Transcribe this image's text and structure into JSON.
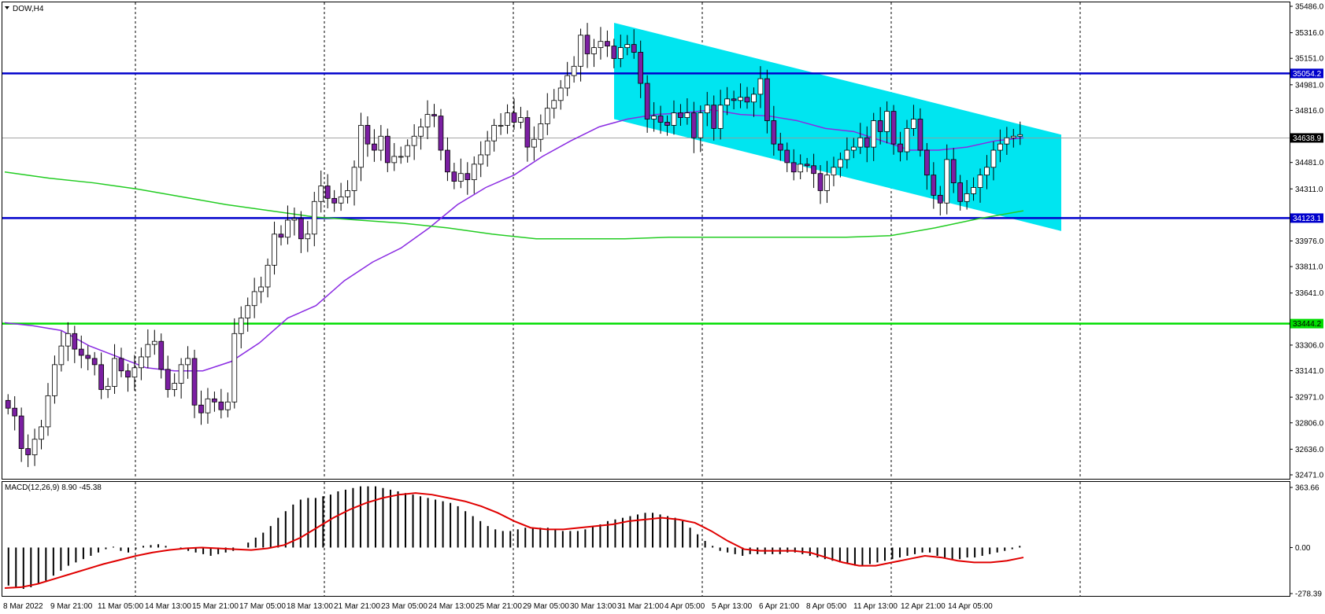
{
  "window_title": "DOW,H4",
  "chart_data": {
    "type": "candlestick",
    "symbol": "DOW",
    "timeframe": "H4",
    "price_range": [
      32471,
      35486
    ],
    "y_ticks": [
      "35486.0",
      "35316.0",
      "35151.0",
      "34981.0",
      "34816.0",
      "34638.9",
      "34481.0",
      "34311.0",
      "34123.1",
      "33976.0",
      "33811.0",
      "33641.0",
      "33306.0",
      "33141.0",
      "32971.0",
      "32806.0",
      "32636.0",
      "32471.0"
    ],
    "x_ticks": [
      "8 Mar 2022",
      "9 Mar 21:00",
      "11 Mar 05:00",
      "14 Mar 13:00",
      "15 Mar 21:00",
      "17 Mar 05:00",
      "18 Mar 13:00",
      "21 Mar 21:00",
      "23 Mar 05:00",
      "24 Mar 13:00",
      "25 Mar 21:00",
      "29 Mar 05:00",
      "30 Mar 13:00",
      "31 Mar 21:00",
      "4 Apr 05:00",
      "5 Apr 13:00",
      "6 Apr 21:00",
      "8 Apr 05:00",
      "11 Apr 13:00",
      "12 Apr 21:00",
      "14 Apr 05:00"
    ],
    "horizontal_levels": [
      {
        "price": 35054.2,
        "label": "35054.2",
        "color": "#0000cc"
      },
      {
        "price": 34123.1,
        "label": "34123.1",
        "color": "#0000cc"
      },
      {
        "price": 33444.2,
        "label": "33444.2",
        "color": "#00dd00"
      }
    ],
    "current_price": {
      "price": 34638.9,
      "label": "34638.9"
    },
    "channel": {
      "color": "#00e5f0",
      "upper_start": 35380,
      "upper_end": 34660,
      "lower_start": 34760,
      "lower_end": 34040
    },
    "colors": {
      "bull": "#ffffff",
      "bear": "#7b1fa2",
      "wick": "#000000",
      "ma_fast": "#8a2be2",
      "ma_slow": "#22cc22"
    },
    "candles_close": [
      32900,
      32850,
      32640,
      32600,
      32700,
      32780,
      32980,
      33180,
      33300,
      33380,
      33280,
      33240,
      33220,
      33180,
      33020,
      33040,
      33220,
      33140,
      33100,
      33160,
      33230,
      33310,
      33330,
      33150,
      33020,
      33060,
      33180,
      33220,
      32920,
      32870,
      32960,
      32940,
      32890,
      32940,
      33380,
      33480,
      33560,
      33650,
      33680,
      33820,
      34020,
      34000,
      34110,
      34120,
      33990,
      34020,
      34230,
      34330,
      34250,
      34220,
      34260,
      34300,
      34450,
      34720,
      34600,
      34560,
      34650,
      34480,
      34520,
      34520,
      34590,
      34650,
      34710,
      34790,
      34780,
      34560,
      34420,
      34360,
      34410,
      34370,
      34470,
      34530,
      34620,
      34720,
      34720,
      34800,
      34740,
      34770,
      34580,
      34630,
      34730,
      34830,
      34880,
      34960,
      35040,
      35100,
      35300,
      35180,
      35220,
      35260,
      35230,
      35150,
      35220,
      35240,
      35190,
      34990,
      34760,
      34780,
      34740,
      34720,
      34800,
      34770,
      34800,
      34640,
      34800,
      34850,
      34700,
      34850,
      34890,
      34880,
      34900,
      34870,
      34920,
      35020,
      34750,
      34600,
      34560,
      34480,
      34420,
      34470,
      34460,
      34410,
      34300,
      34400,
      34450,
      34500,
      34560,
      34580,
      34640,
      34580,
      34750,
      34680,
      34810,
      34600,
      34550,
      34700,
      34760,
      34560,
      34400,
      34270,
      34220,
      34500,
      34350,
      34230,
      34280,
      34320,
      34400,
      34450,
      34560,
      34600,
      34640,
      34650,
      34660
    ],
    "ma_fast": [
      33450,
      33430,
      33400,
      33300,
      33230,
      33160,
      33140,
      33140,
      33200,
      33320,
      33480,
      33560,
      33720,
      33840,
      33930,
      34060,
      34210,
      34320,
      34400,
      34520,
      34620,
      34710,
      34760,
      34790,
      34800,
      34820,
      34790,
      34780,
      34750,
      34700,
      34680,
      34620,
      34560,
      34560,
      34580,
      34620,
      34640
    ],
    "ma_slow": [
      34420,
      34380,
      34350,
      34310,
      34260,
      34210,
      34170,
      34130,
      34110,
      34090,
      34060,
      34020,
      33990,
      33990,
      33990,
      34000,
      34000,
      34000,
      34000,
      34000,
      34010,
      34060,
      34120,
      34170
    ],
    "macd": {
      "label": "MACD(12,26,9) 8.90 -45.38",
      "y_ticks": [
        "363.66",
        "0.00",
        "-278.39"
      ],
      "range": [
        -278.39,
        363.66
      ],
      "histogram": [
        -230,
        -240,
        -250,
        -240,
        -220,
        -200,
        -170,
        -140,
        -110,
        -90,
        -70,
        -50,
        -30,
        -10,
        5,
        -20,
        -30,
        -10,
        10,
        15,
        20,
        10,
        0,
        -10,
        -20,
        -30,
        -40,
        -50,
        -40,
        -30,
        -20,
        0,
        30,
        60,
        90,
        130,
        180,
        220,
        260,
        290,
        300,
        300,
        310,
        320,
        340,
        350,
        360,
        370,
        370,
        370,
        360,
        350,
        340,
        330,
        320,
        310,
        300,
        290,
        280,
        270,
        250,
        220,
        190,
        160,
        130,
        110,
        100,
        100,
        110,
        120,
        120,
        120,
        120,
        110,
        100,
        100,
        100,
        110,
        130,
        140,
        160,
        170,
        180,
        190,
        200,
        210,
        210,
        200,
        190,
        180,
        160,
        120,
        80,
        40,
        10,
        -20,
        -30,
        -40,
        -50,
        -40,
        -40,
        -40,
        -40,
        -40,
        -30,
        -30,
        -40,
        -50,
        -60,
        -70,
        -80,
        -90,
        -100,
        -110,
        -110,
        -100,
        -90,
        -80,
        -70,
        -60,
        -50,
        -40,
        -30,
        -30,
        -50,
        -60,
        -70,
        -70,
        -60,
        -60,
        -50,
        -40,
        -30,
        -20,
        -10,
        10
      ],
      "signal": [
        -245,
        -240,
        -220,
        -190,
        -160,
        -130,
        -100,
        -75,
        -50,
        -30,
        -15,
        -5,
        0,
        -5,
        -10,
        -15,
        -5,
        15,
        60,
        120,
        180,
        230,
        270,
        300,
        320,
        330,
        320,
        300,
        280,
        250,
        210,
        160,
        120,
        110,
        110,
        120,
        130,
        140,
        160,
        170,
        180,
        170,
        150,
        100,
        40,
        -10,
        -20,
        -20,
        -20,
        -30,
        -60,
        -90,
        -110,
        -110,
        -90,
        -70,
        -50,
        -60,
        -80,
        -90,
        -90,
        -80,
        -60
      ]
    }
  }
}
